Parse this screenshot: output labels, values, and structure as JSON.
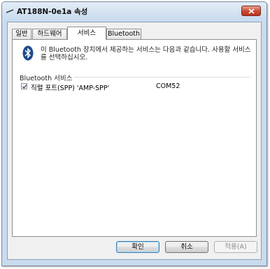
{
  "window": {
    "title": "AT188N-0e1a 속성"
  },
  "tabs": [
    {
      "label": "일반"
    },
    {
      "label": "하드웨어"
    },
    {
      "label": "서비스"
    },
    {
      "label": "Bluetooth"
    }
  ],
  "panel": {
    "description": "이 Bluetooth 장치에서 제공하는 서비스는 다음과 같습니다. 사용할 서비스를 선택하십시오.",
    "group_label": "Bluetooth 서비스",
    "services": [
      {
        "name": "직렬 포트(SPP) 'AMP-SPP'",
        "port": "COM52",
        "checked": true
      }
    ]
  },
  "buttons": {
    "ok": "확인",
    "cancel": "취소",
    "apply": "적용(A)"
  },
  "icons": {
    "window_icon": "bluetooth-device-icon",
    "close": "close-icon",
    "panel_icon": "bluetooth-icon",
    "check": "check-icon"
  },
  "colors": {
    "title_bar": "#c9dbee",
    "close_button": "#c84a32",
    "bluetooth_icon": "#1d4a8c"
  }
}
